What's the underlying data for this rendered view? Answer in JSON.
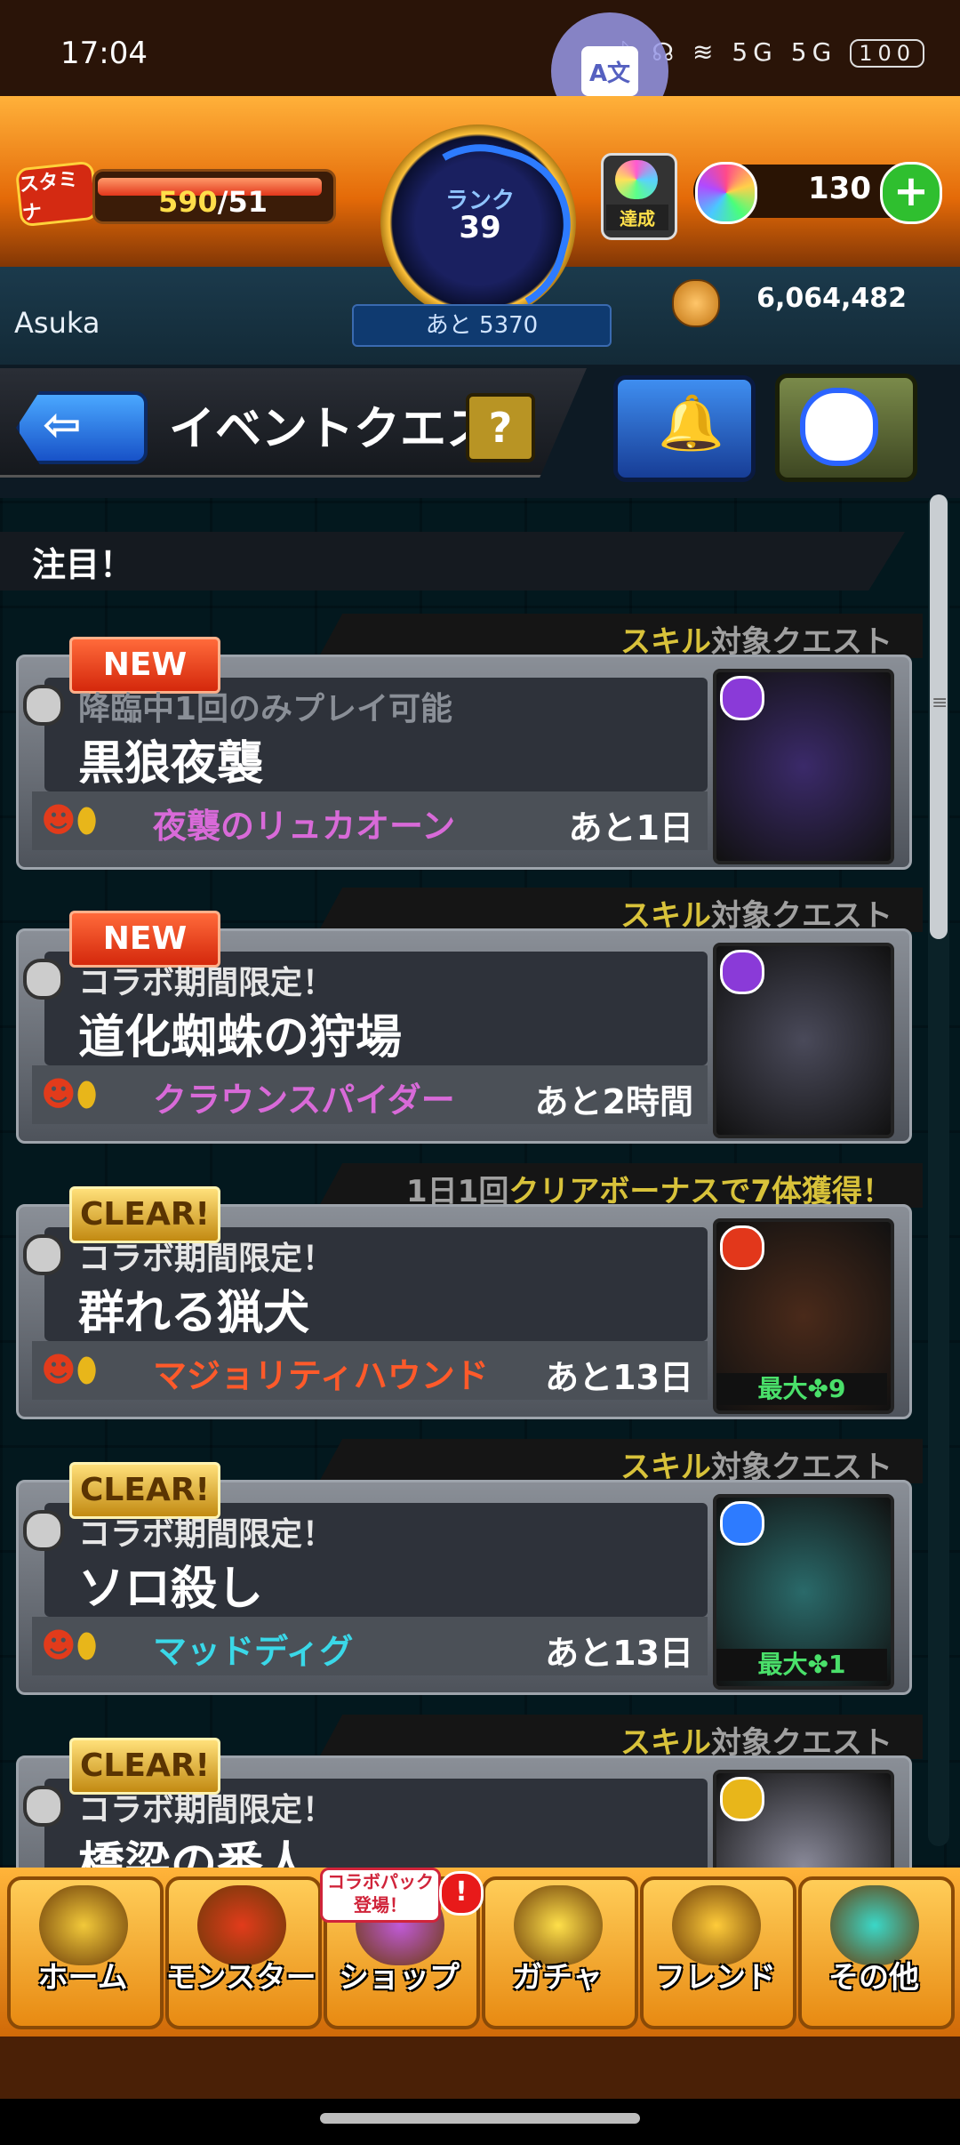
{
  "status_bar": {
    "time": "17:04",
    "icons": "ᛒ ☊ ≋ 5G 5G",
    "battery": "100"
  },
  "header": {
    "stamina_label": "スタミナ",
    "stamina_current": "590",
    "stamina_max": "/51",
    "rank_label": "ランク",
    "rank_value": "39",
    "next_exp": "あと 5370",
    "achievement_label": "達成",
    "orb_count": "130",
    "username": "Asuka",
    "gold": "6,064,482"
  },
  "title_row": {
    "back_arrow": "⇦",
    "page_title": "イベントクエスト",
    "help": "?"
  },
  "section": {
    "title": "注目！"
  },
  "quests": [
    {
      "badge": "NEW",
      "tab_prefix": "",
      "tab_highlight": "スキル",
      "tab_suffix": "対象クエスト",
      "subtitle": "降臨中1回のみプレイ可能",
      "name": "黒狼夜襲",
      "boss": "夜襲のリュカオーン",
      "boss_color": "#d86ad8",
      "remaining": "あと1日",
      "max_label": "",
      "element_color": "#8a3ad8",
      "thumb_color": "#3b2a6a"
    },
    {
      "badge": "NEW",
      "tab_prefix": "",
      "tab_highlight": "スキル",
      "tab_suffix": "対象クエスト",
      "subtitle": "コラボ期間限定！",
      "name": "道化蜘蛛の狩場",
      "boss": "クラウンスパイダー",
      "boss_color": "#d86ad8",
      "remaining": "あと2時間",
      "max_label": "",
      "element_color": "#8a3ad8",
      "thumb_color": "#4a4a5a"
    },
    {
      "badge": "CLEAR!",
      "tab_prefix": "1日1回",
      "tab_highlight": "クリアボーナスで7体獲得！",
      "tab_suffix": "",
      "subtitle": "コラボ期間限定！",
      "name": "群れる猟犬",
      "boss": "マジョリティハウンド",
      "boss_color": "#ff5a2a",
      "remaining": "あと13日",
      "max_label": "最大✤9",
      "element_color": "#e2371b",
      "thumb_color": "#4a2a1a"
    },
    {
      "badge": "CLEAR!",
      "tab_prefix": "",
      "tab_highlight": "スキル",
      "tab_suffix": "対象クエスト",
      "subtitle": "コラボ期間限定！",
      "name": "ソロ殺し",
      "boss": "マッドディグ",
      "boss_color": "#3ad8e8",
      "remaining": "あと13日",
      "max_label": "最大✤1",
      "element_color": "#2d7bff",
      "thumb_color": "#2a6a6a"
    },
    {
      "badge": "CLEAR!",
      "tab_prefix": "",
      "tab_highlight": "スキル",
      "tab_suffix": "対象クエスト",
      "subtitle": "コラボ期間限定！",
      "name": "橋梁の番人",
      "boss": "",
      "boss_color": "#ffffff",
      "remaining": "",
      "max_label": "",
      "element_color": "#e8b61a",
      "thumb_color": "#8a8a9a"
    }
  ],
  "bottom_nav": {
    "items": [
      {
        "label": "ホーム"
      },
      {
        "label": "モンスター"
      },
      {
        "label": "ショップ"
      },
      {
        "label": "ガチャ"
      },
      {
        "label": "フレンド"
      },
      {
        "label": "その他"
      }
    ],
    "shop_popup": "コラボパック\n登場！",
    "shop_alert": "!"
  }
}
